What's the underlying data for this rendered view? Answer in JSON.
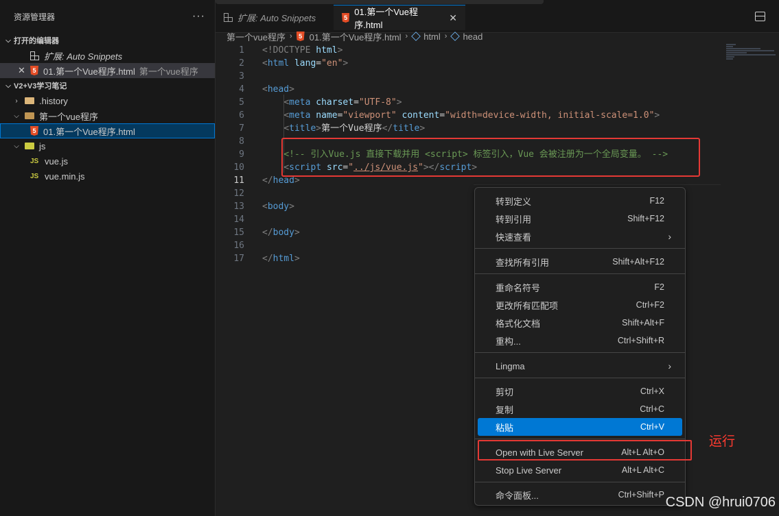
{
  "sidebar": {
    "title": "资源管理器",
    "more": "···",
    "open_editors": {
      "title": "打开的编辑器",
      "items": [
        {
          "label": "扩展: Auto Snippets"
        },
        {
          "label": "01.第一个Vue程序.html",
          "desc": "第一个vue程序"
        }
      ]
    },
    "workspace": {
      "title": "V2+V3学习笔记",
      "items": [
        ".history",
        "第一个vue程序",
        "01.第一个Vue程序.html",
        "js",
        "vue.js",
        "vue.min.js"
      ]
    }
  },
  "tabs": [
    {
      "label": "扩展: Auto Snippets"
    },
    {
      "label": "01.第一个Vue程序.html",
      "close": "✕"
    }
  ],
  "breadcrumb": [
    "第一个vue程序",
    "01.第一个Vue程序.html",
    "html",
    "head"
  ],
  "editor": {
    "lines": [
      "1",
      "2",
      "3",
      "4",
      "5",
      "6",
      "7",
      "8",
      "9",
      "10",
      "11",
      "12",
      "13",
      "14",
      "15",
      "16",
      "17"
    ],
    "active_line": "11",
    "code": {
      "l1_doctype": "<!DOCTYPE",
      "l1_html": "html",
      "l1_end": ">",
      "l5_charset_val": "\"UTF-8\"",
      "l6_name_val": "\"viewport\"",
      "l6_content_val": "\"width=device-width, initial-scale=1.0\"",
      "l7_title": "第一个Vue程序",
      "l9_comment": "<!-- 引入Vue.js 直接下载并用 <script> 标签引入，Vue 会被注册为一个全局变量。 -->",
      "l10_src": "../js/vue.js"
    }
  },
  "context_menu": {
    "items": [
      {
        "label": "转到定义",
        "kb": "F12"
      },
      {
        "label": "转到引用",
        "kb": "Shift+F12"
      },
      {
        "label": "快速查看",
        "kb": "›"
      },
      {
        "label": "查找所有引用",
        "kb": "Shift+Alt+F12"
      },
      {
        "label": "重命名符号",
        "kb": "F2"
      },
      {
        "label": "更改所有匹配项",
        "kb": "Ctrl+F2"
      },
      {
        "label": "格式化文档",
        "kb": "Shift+Alt+F"
      },
      {
        "label": "重构...",
        "kb": "Ctrl+Shift+R"
      },
      {
        "label": "Lingma",
        "kb": "›"
      },
      {
        "label": "剪切",
        "kb": "Ctrl+X"
      },
      {
        "label": "复制",
        "kb": "Ctrl+C"
      },
      {
        "label": "粘贴",
        "kb": "Ctrl+V"
      },
      {
        "label": "Open with Live Server",
        "kb": "Alt+L Alt+O"
      },
      {
        "label": "Stop Live Server",
        "kb": "Alt+L Alt+C"
      },
      {
        "label": "命令面板...",
        "kb": "Ctrl+Shift+P"
      }
    ]
  },
  "annotation": "运行",
  "watermark": "CSDN @hrui0706",
  "colors": {
    "accent": "#0078d4",
    "annotation_red": "#e53935"
  }
}
